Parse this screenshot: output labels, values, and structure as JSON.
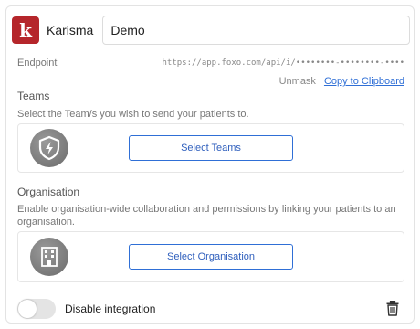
{
  "header": {
    "logo_letter": "k",
    "brand_name": "Karisma",
    "integration_name_value": "Demo"
  },
  "endpoint": {
    "label": "Endpoint",
    "url_masked": "https://app.foxo.com/api/i/••••••••-••••••••-••••",
    "unmask_label": "Unmask",
    "copy_label": "Copy to Clipboard"
  },
  "teams": {
    "title": "Teams",
    "description": "Select the Team/s you wish to send your patients to.",
    "button_label": "Select Teams",
    "icon": "shield-bolt-icon"
  },
  "organisation": {
    "title": "Organisation",
    "description": "Enable organisation-wide collaboration and permissions by linking your patients to an organisation.",
    "button_label": "Select Organisation",
    "icon": "building-icon"
  },
  "footer": {
    "toggle_label": "Disable integration",
    "toggle_state": "off",
    "delete_icon": "trash-icon"
  },
  "colors": {
    "brand_red": "#b5262b",
    "accent_blue": "#2f6fd6"
  }
}
